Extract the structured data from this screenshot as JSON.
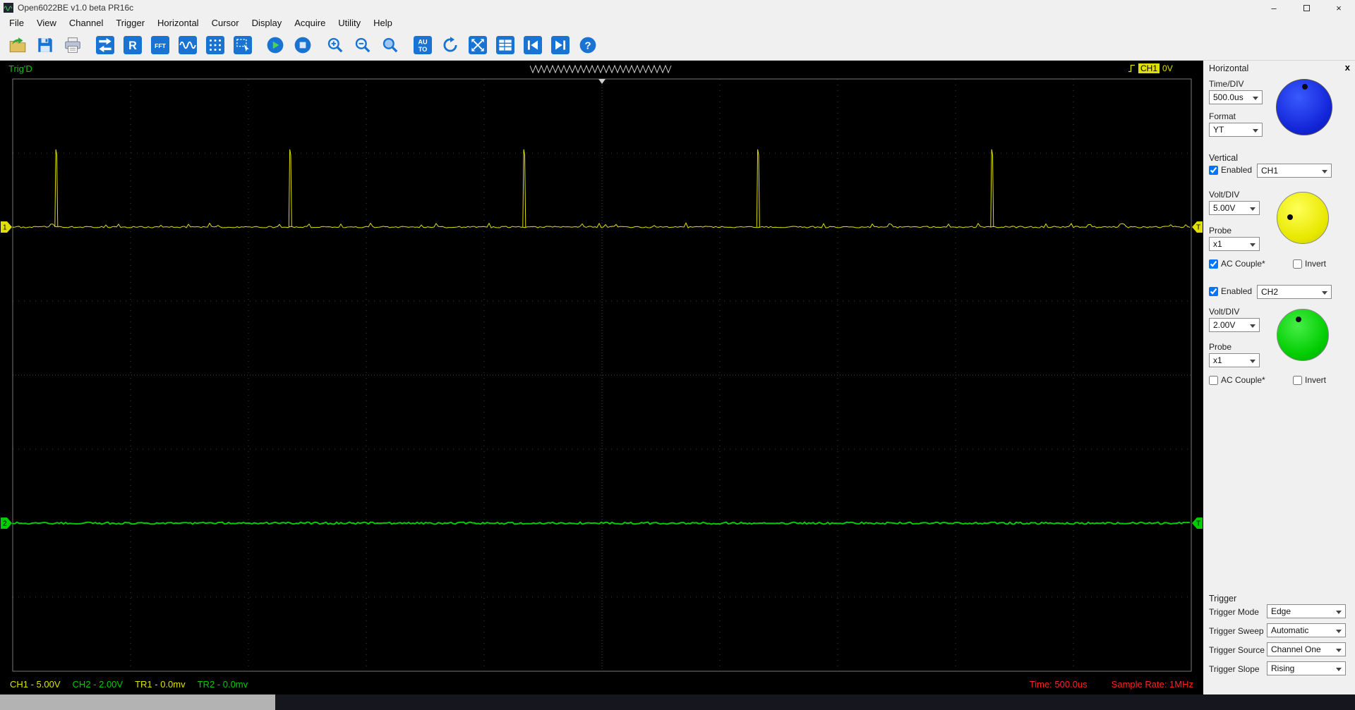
{
  "window": {
    "title": "Open6022BE v1.0 beta PR16c",
    "minimize_glyph": "–",
    "close_glyph": "×"
  },
  "menu": {
    "items": [
      "File",
      "View",
      "Channel",
      "Trigger",
      "Horizontal",
      "Cursor",
      "Display",
      "Acquire",
      "Utility",
      "Help"
    ]
  },
  "toolbar": {
    "icons": [
      "open",
      "save",
      "print",
      "swap-channels",
      "reference",
      "fft",
      "waveform-mode",
      "sample-display",
      "selection",
      "start",
      "stop",
      "zoom-in",
      "zoom-out",
      "zoom-window",
      "autoset",
      "refresh",
      "fullscreen",
      "measure-table",
      "previous-frame",
      "next-frame",
      "help"
    ],
    "reference_label": "R",
    "fft_label": "FFT",
    "autoset_line1": "AU",
    "autoset_line2": "TO",
    "help_label": "?"
  },
  "scope": {
    "trig_status": "Trig'D",
    "trigger_indicator": {
      "channel": "CH1",
      "level": "0V"
    },
    "grid": {
      "cols": 10,
      "rows": 8
    },
    "ch1": {
      "label": "1",
      "color": "#e0e000",
      "baseline_div": 2,
      "spikes_start_div": 0.37,
      "spike_period_div": 1.985,
      "spike_height_div": 1.05
    },
    "ch2": {
      "label": "2",
      "color": "#00cc00",
      "baseline_div": 6
    },
    "trigger_marker_label": "T",
    "status": {
      "ch1": "CH1 - 5.00V",
      "ch2": "CH2 - 2.00V",
      "tr1": "TR1 - 0.0mv",
      "tr2": "TR2 - 0.0mv",
      "time": "Time: 500.0us",
      "sample_rate": "Sample Rate: 1MHz"
    },
    "colors": {
      "status_info": "#ff2222",
      "trig_status": "#00cc00",
      "grid": "#3f3f3f",
      "background": "#000000"
    }
  },
  "panel": {
    "close_label": "x",
    "horizontal": {
      "title": "Horizontal",
      "time_div_label": "Time/DIV",
      "time_div_value": "500.0us",
      "format_label": "Format",
      "format_value": "YT",
      "knob_color": "#1226d8"
    },
    "vertical": {
      "title": "Vertical",
      "ch1": {
        "enabled_label": "Enabled",
        "enabled": true,
        "channel_value": "CH1",
        "volt_div_label": "Volt/DIV",
        "volt_div_value": "5.00V",
        "probe_label": "Probe",
        "probe_value": "x1",
        "ac_couple_label": "AC Couple*",
        "ac_couple": true,
        "invert_label": "Invert",
        "invert": false,
        "knob_color": "#e8e800"
      },
      "ch2": {
        "enabled_label": "Enabled",
        "enabled": true,
        "channel_value": "CH2",
        "volt_div_label": "Volt/DIV",
        "volt_div_value": "2.00V",
        "probe_label": "Probe",
        "probe_value": "x1",
        "ac_couple_label": "AC Couple*",
        "ac_couple": false,
        "invert_label": "Invert",
        "invert": false,
        "knob_color": "#00cc00"
      }
    },
    "trigger": {
      "title": "Trigger",
      "rows": [
        {
          "label": "Trigger Mode",
          "value": "Edge"
        },
        {
          "label": "Trigger Sweep",
          "value": "Automatic"
        },
        {
          "label": "Trigger Source",
          "value": "Channel One"
        },
        {
          "label": "Trigger Slope",
          "value": "Rising"
        }
      ]
    }
  }
}
